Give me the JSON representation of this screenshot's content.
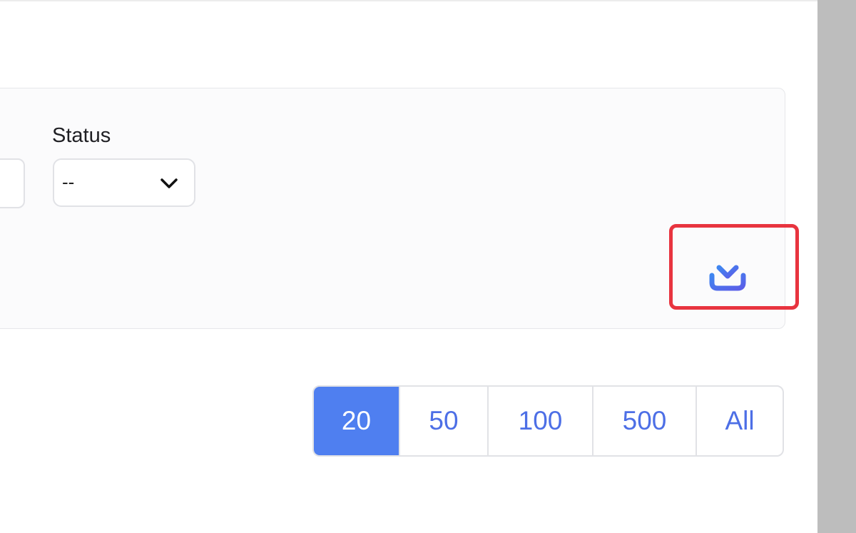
{
  "filters": {
    "status": {
      "label": "Status",
      "value": "--"
    }
  },
  "actions": {
    "download_icon": "download-icon"
  },
  "pagination": {
    "options": [
      "20",
      "50",
      "100",
      "500",
      "All"
    ],
    "selected": "20"
  },
  "colors": {
    "accent": "#4f7ff0",
    "link": "#4d6fe6",
    "highlight": "#e8343f"
  }
}
